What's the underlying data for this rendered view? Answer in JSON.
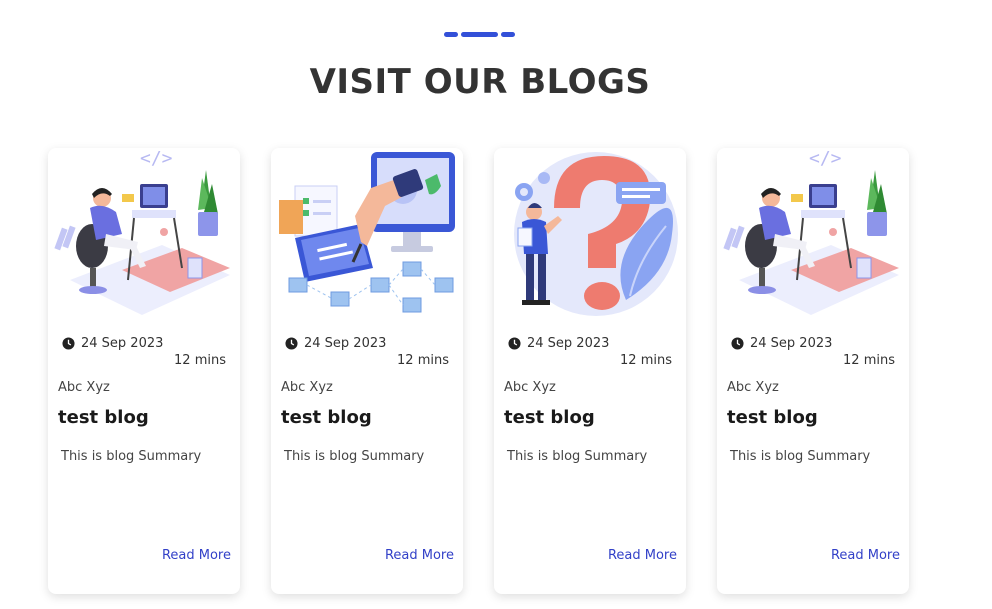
{
  "section": {
    "title": "VISIT OUR BLOGS",
    "accent_color": "#3350d8"
  },
  "cards": [
    {
      "image": "developer-desk-illustration",
      "date": "24 Sep 2023",
      "read_time": "12 mins",
      "author": "Abc Xyz",
      "title": "test blog",
      "summary": "This is blog Summary",
      "link_label": "Read More"
    },
    {
      "image": "digital-signature-illustration",
      "date": "24 Sep 2023",
      "read_time": "12 mins",
      "author": "Abc Xyz",
      "title": "test blog",
      "summary": "This is blog Summary",
      "link_label": "Read More"
    },
    {
      "image": "question-mark-illustration",
      "date": "24 Sep 2023",
      "read_time": "12 mins",
      "author": "Abc Xyz",
      "title": "test blog",
      "summary": "This is blog Summary",
      "link_label": "Read More"
    },
    {
      "image": "developer-desk-illustration",
      "date": "24 Sep 2023",
      "read_time": "12 mins",
      "author": "Abc Xyz",
      "title": "test blog",
      "summary": "This is blog Summary",
      "link_label": "Read More"
    }
  ],
  "colors": {
    "link": "#3341c8",
    "text": "#333333"
  }
}
